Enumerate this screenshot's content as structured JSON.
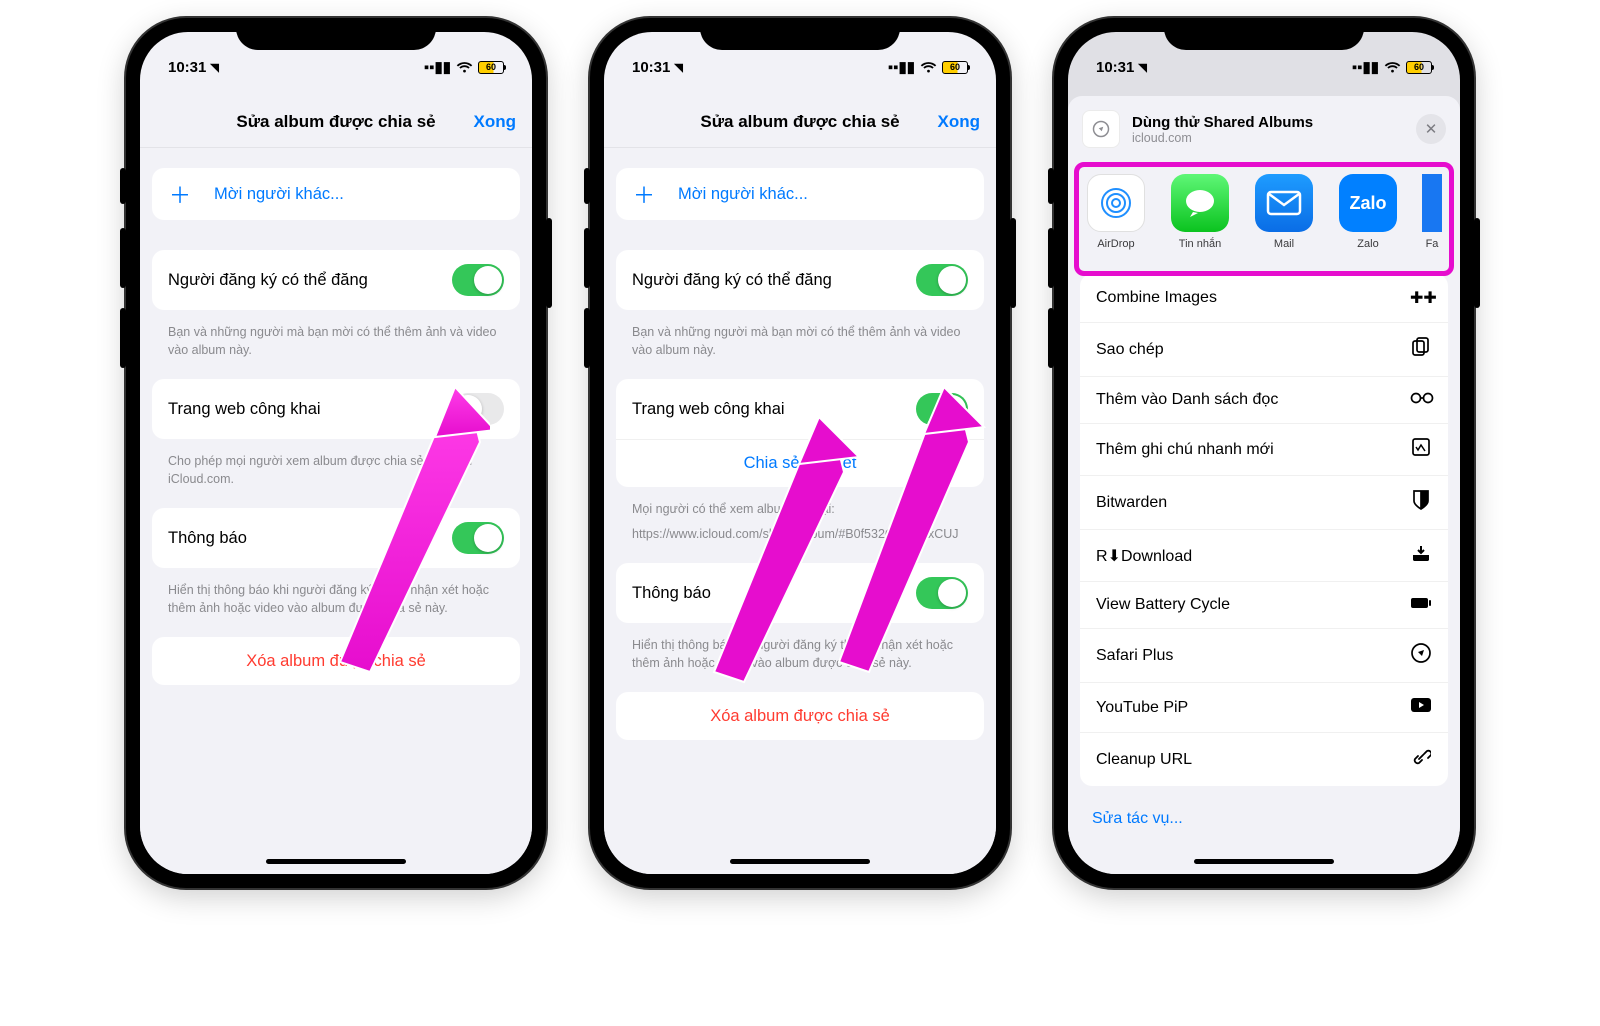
{
  "status": {
    "time": "10:31",
    "battery": "60"
  },
  "edit": {
    "title": "Sửa album được chia sẻ",
    "done": "Xong",
    "invite": "Mời người khác...",
    "subscribers_can_post": "Người đăng ký có thể đăng",
    "subscribers_hint": "Bạn và những người mà bạn mời có thể thêm ảnh và video vào album này.",
    "public_website": "Trang web công khai",
    "public_hint_off": "Cho phép mọi người xem album được chia sẻ này trên iCloud.com.",
    "share_link": "Chia sẻ liên kết",
    "public_hint_on": "Mọi người có thể xem album này tại:",
    "public_url": "https://www.icloud.com/sharedalbum/#B0f532ODWxxxCUJ",
    "notifications": "Thông báo",
    "notif_hint": "Hiển thị thông báo khi người đăng ký thích, nhận xét hoặc thêm ảnh hoặc video vào album được chia sẻ này.",
    "delete": "Xóa album được chia sẻ"
  },
  "share": {
    "title": "Dùng thử Shared Albums",
    "subtitle": "icloud.com",
    "apps": {
      "airdrop": "AirDrop",
      "messages": "Tin nhắn",
      "mail": "Mail",
      "zalo": "Zalo",
      "facebook": "Facebook"
    },
    "actions": {
      "combine": "Combine Images",
      "copy": "Sao chép",
      "reading_list": "Thêm vào Danh sách đọc",
      "quick_note": "Thêm ghi chú nhanh mới",
      "bitwarden": "Bitwarden",
      "rdownload": "R⬇Download",
      "battery": "View Battery Cycle",
      "safari_plus": "Safari Plus",
      "youtube_pip": "YouTube PiP",
      "cleanup_url": "Cleanup URL"
    },
    "edit_actions": "Sửa tác vụ..."
  }
}
